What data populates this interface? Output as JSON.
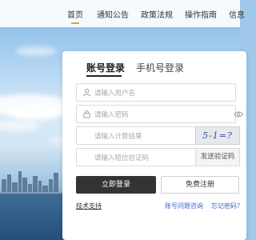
{
  "nav": {
    "items": [
      {
        "label": "首页",
        "active": true
      },
      {
        "label": "通知公告"
      },
      {
        "label": "政策法规"
      },
      {
        "label": "操作指南"
      },
      {
        "label": "信息"
      }
    ],
    "accent_color": "#d9a441"
  },
  "login": {
    "tabs": {
      "account": "账号登录",
      "phone": "手机号登录"
    },
    "fields": {
      "username_placeholder": "请输入用户名",
      "password_placeholder": "请输入密码",
      "calc_placeholder": "请输入计算结果",
      "sms_placeholder": "请输入短信验证码"
    },
    "captcha_text": "5-1=?",
    "sms_button": "发送验证码",
    "login_button": "立即登录",
    "register_button": "免费注册",
    "links": {
      "support": "技术支持",
      "faq": "账号问题咨询",
      "forgot": "忘记密码？"
    },
    "icons": {
      "username": "user-icon",
      "password": "lock-icon",
      "show_password": "eye-icon"
    }
  }
}
